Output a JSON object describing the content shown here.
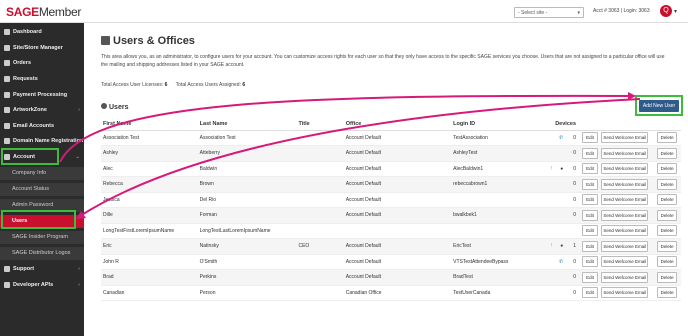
{
  "header": {
    "logo_sage": "SAGE",
    "logo_member": "Member",
    "site_select": "- Select site -",
    "acct_info": "Acct # 3063 | Login: 3063",
    "avatar_letter": "Q",
    "avatar_caret": "▾"
  },
  "sidebar": {
    "items": [
      {
        "label": "Dashboard"
      },
      {
        "label": "Site/Store Manager"
      },
      {
        "label": "Orders"
      },
      {
        "label": "Requests"
      },
      {
        "label": "Payment Processing"
      },
      {
        "label": "ArtworkZone"
      },
      {
        "label": "Email Accounts"
      },
      {
        "label": "Domain Name Registration"
      },
      {
        "label": "Account"
      }
    ],
    "account_sub": [
      {
        "label": "Company Info"
      },
      {
        "label": "Account Status"
      },
      {
        "label": "Admin Password"
      },
      {
        "label": "Users"
      },
      {
        "label": "SAGE Insider Program"
      },
      {
        "label": "SAGE Distributor Logos"
      }
    ],
    "bottom": [
      {
        "label": "Support"
      },
      {
        "label": "Developer APIs"
      }
    ],
    "arrow_right": "›",
    "arrow_down": "⌄"
  },
  "main": {
    "title": "Users & Offices",
    "description": "This area allows you, as an administrator, to configure users for your account. You can customize access rights for each user so that they only have access to the specific SAGE services you choose. Users that are not assigned to a particular office will use the mailing and shipping addresses listed in your SAGE account.",
    "total_licenses_label": "Total Access User Licenses:",
    "total_licenses_value": "6",
    "total_assigned_label": "Total Access Users Assigned:",
    "total_assigned_value": "6",
    "users_header": "Users",
    "add_button": "Add New User"
  },
  "table": {
    "columns": [
      "First Name",
      "Last Name",
      "Title",
      "Office",
      "Login ID",
      "Devices"
    ],
    "edit_label": "Edit",
    "welcome_label": "Send Welcome Email",
    "delete_label": "Delete",
    "rows": [
      {
        "first": "Association Test",
        "last": "Association Test",
        "title": "",
        "office": "Account Default",
        "login": "TestAssociation",
        "icons": "phone",
        "devices": "0"
      },
      {
        "first": "Ashley",
        "last": "Atteberry",
        "title": "",
        "office": "Account Default",
        "login": "AshleyTest",
        "icons": "",
        "devices": "0"
      },
      {
        "first": "Alec",
        "last": "Baldwin",
        "title": "",
        "office": "Account Default",
        "login": "AlecBaldwin1",
        "icons": "warn-user",
        "devices": "0"
      },
      {
        "first": "Rebecca",
        "last": "Brown",
        "title": "",
        "office": "Account Default",
        "login": "rebeccabrown1",
        "icons": "",
        "devices": "0"
      },
      {
        "first": "Jessica",
        "last": "Del Rio",
        "title": "",
        "office": "Account Default",
        "login": "",
        "icons": "",
        "devices": "0"
      },
      {
        "first": "Dille",
        "last": "Forman",
        "title": "",
        "office": "Account Default",
        "login": "bwalkbek1",
        "icons": "",
        "devices": "0"
      },
      {
        "first": "LongTestFirstLoremIpsumName",
        "last": "LongTestLastLoremIpsumName",
        "title": "",
        "office": "",
        "login": "",
        "icons": "",
        "devices": ""
      },
      {
        "first": "Eric",
        "last": "Natinsky",
        "title": "CEO",
        "office": "Account Default",
        "login": "EricTest",
        "icons": "warn-user",
        "devices": "1"
      },
      {
        "first": "John R",
        "last": "O'Smith",
        "title": "",
        "office": "Account Default",
        "login": "VTSTestAttendeeBypass",
        "icons": "phone",
        "devices": "0"
      },
      {
        "first": "Brad",
        "last": "Perkins",
        "title": "",
        "office": "Account Default",
        "login": "BradTest",
        "icons": "",
        "devices": "0"
      },
      {
        "first": "Canadian",
        "last": "Person",
        "title": "",
        "office": "Canadian Office",
        "login": "TestUserCanada",
        "icons": "",
        "devices": "0"
      }
    ]
  },
  "colors": {
    "brand_red": "#c8102e",
    "sidebar_bg": "#2b2b2b",
    "button_blue": "#2e5b8a",
    "highlight_green": "#3dbb3d",
    "arrow_magenta": "#d6197a"
  }
}
